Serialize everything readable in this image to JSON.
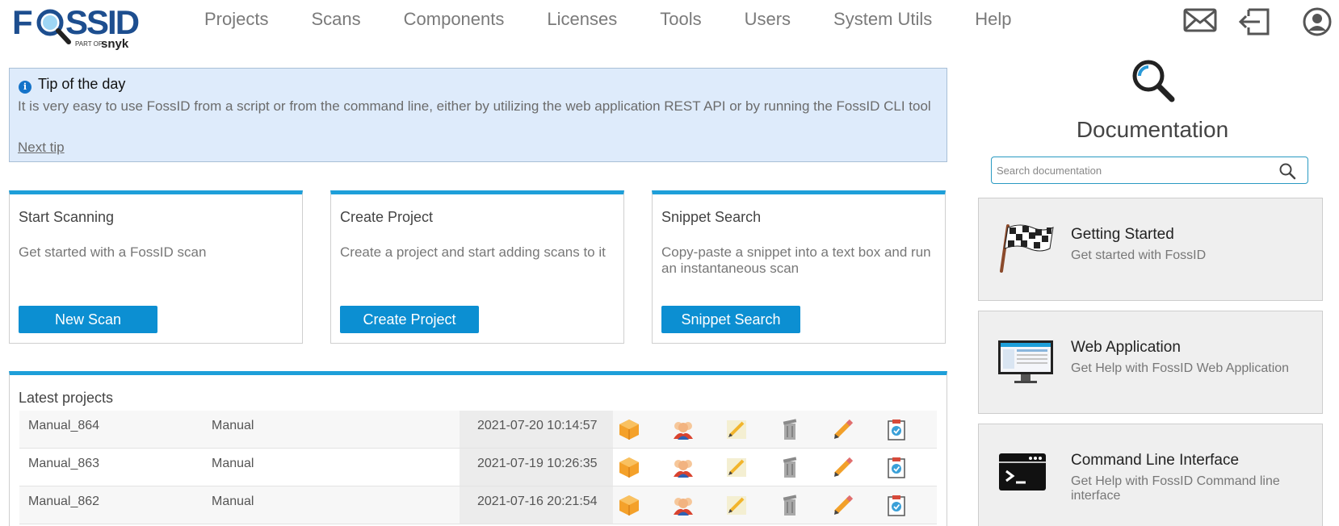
{
  "logo": {
    "brand": "FOSSID",
    "part_of": "PART OF",
    "parent": "snyk"
  },
  "nav": {
    "items": [
      "Projects",
      "Scans",
      "Components",
      "Licenses",
      "Tools",
      "Users",
      "System Utils",
      "Help"
    ]
  },
  "header_icons": [
    "mail-icon",
    "logout-icon",
    "user-icon"
  ],
  "tip": {
    "title": "Tip of the day",
    "text": "It is very easy to use FossID from a script or from the command line, either by utilizing the web application REST API or by running the FossID CLI tool",
    "next_label": "Next tip"
  },
  "cards": [
    {
      "title": "Start Scanning",
      "description": "Get started with a FossID scan",
      "button": "New Scan"
    },
    {
      "title": "Create Project",
      "description": "Create a project and start adding scans to it",
      "button": "Create Project"
    },
    {
      "title": "Snippet Search",
      "description": "Copy-paste a snippet into a text box and run an instantaneous scan",
      "button": "Snippet Search"
    }
  ],
  "latest_projects": {
    "title": "Latest projects",
    "rows": [
      {
        "name": "Manual_864",
        "type": "Manual",
        "date": "2021-07-20 10:14:57"
      },
      {
        "name": "Manual_863",
        "type": "Manual",
        "date": "2021-07-19 10:26:35"
      },
      {
        "name": "Manual_862",
        "type": "Manual",
        "date": "2021-07-16 20:21:54"
      }
    ],
    "row_icons": [
      "package-icon",
      "users-icon",
      "note-edit-icon",
      "trash-icon",
      "pencil-icon",
      "clipboard-report-icon"
    ]
  },
  "documentation": {
    "title": "Documentation",
    "search_placeholder": "Search documentation",
    "items": [
      {
        "title": "Getting Started",
        "subtitle": "Get started with FossID",
        "icon": "checkered-flag-icon"
      },
      {
        "title": "Web Application",
        "subtitle": "Get Help with FossID Web Application",
        "icon": "monitor-icon"
      },
      {
        "title": "Command Line Interface",
        "subtitle": "Get Help with FossID Command line interface",
        "icon": "terminal-icon"
      }
    ]
  },
  "colors": {
    "accent": "#1e9fd9",
    "button": "#0c8fd2",
    "tip_bg": "#deebfb",
    "logo": "#1d4e8f"
  }
}
